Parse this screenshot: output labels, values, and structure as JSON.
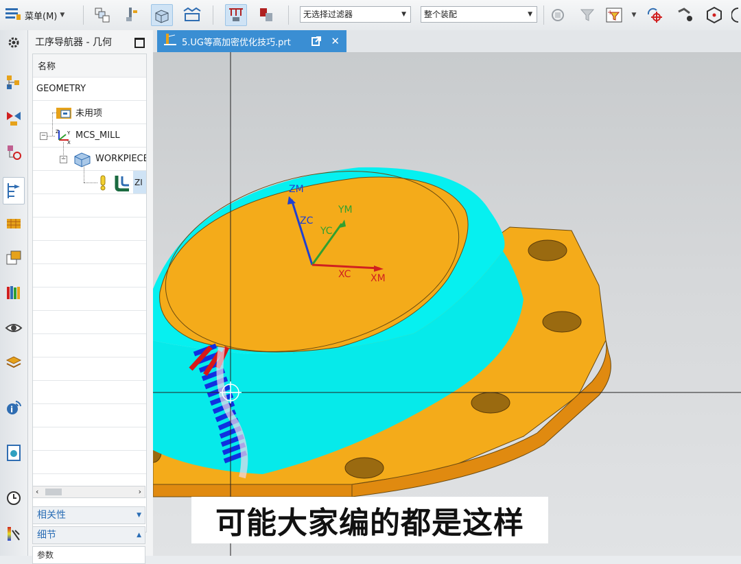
{
  "toolbar": {
    "menu_label": "菜单(M)",
    "filter_select": "无选择过滤器",
    "assembly_select": "整个装配"
  },
  "navigator": {
    "title": "工序导航器 - 几何",
    "column_header": "名称",
    "rows": [
      {
        "label": "GEOMETRY"
      },
      {
        "label": "未用项"
      },
      {
        "label": "MCS_MILL"
      },
      {
        "label": "WORKPIECE"
      },
      {
        "label": "ZI"
      }
    ],
    "sections": {
      "relevance": "相关性",
      "details": "细节",
      "params": "参数"
    }
  },
  "document": {
    "tab_title": "5.UG等高加密优化技巧.prt"
  },
  "viewport": {
    "axis_labels": {
      "zm": "ZM",
      "zc": "ZC",
      "ym": "YM",
      "yc": "YC",
      "xc": "XC",
      "xm": "XM"
    }
  },
  "caption": "可能大家编的都是这样",
  "colors": {
    "part_orange": "#f4ab1a",
    "machined_cyan": "#06f0f0",
    "toolpath_blue": "#1030e0",
    "tab_blue": "#3a8ed3"
  }
}
